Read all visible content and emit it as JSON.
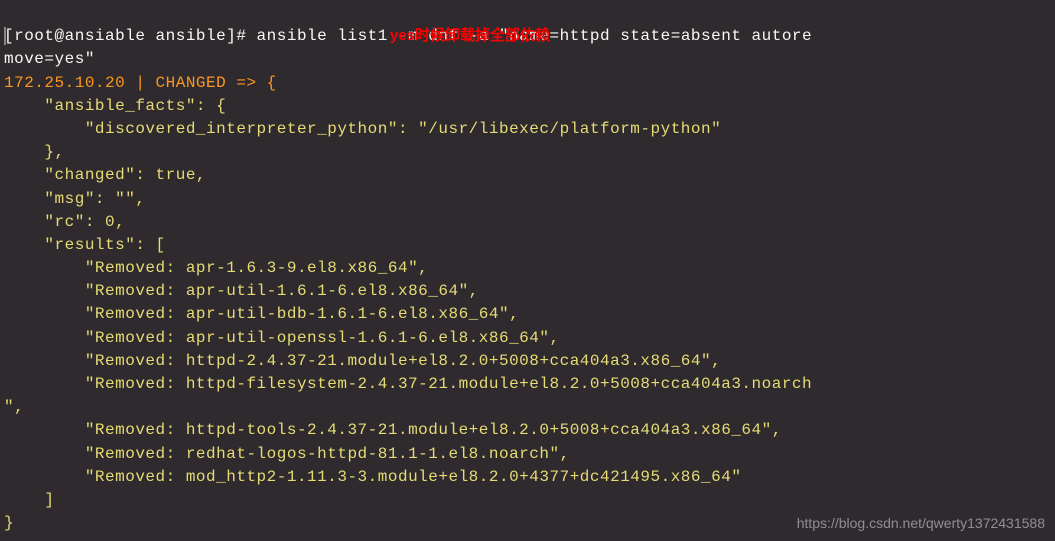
{
  "terminal": {
    "prompt": "[root@ansiable ansible]# ",
    "command": "ansible list1 -m dnf -a \"name=httpd state=absent autoremove=yes\"",
    "host_status": "172.25.10.20 | CHANGED => {",
    "ansible_facts_key": "    \"ansible_facts\": {",
    "interpreter_line": "        \"discovered_interpreter_python\": \"/usr/libexec/platform-python\"",
    "close_brace1": "    },",
    "changed_line": "    \"changed\": true,",
    "msg_line": "    \"msg\": \"\",",
    "rc_line": "    \"rc\": 0,",
    "results_open": "    \"results\": [",
    "results": [
      "        \"Removed: apr-1.6.3-9.el8.x86_64\",",
      "        \"Removed: apr-util-1.6.1-6.el8.x86_64\",",
      "        \"Removed: apr-util-bdb-1.6.1-6.el8.x86_64\",",
      "        \"Removed: apr-util-openssl-1.6.1-6.el8.x86_64\",",
      "        \"Removed: httpd-2.4.37-21.module+el8.2.0+5008+cca404a3.x86_64\",",
      "        \"Removed: httpd-filesystem-2.4.37-21.module+el8.2.0+5008+cca404a3.noarch\",",
      "        \"Removed: httpd-tools-2.4.37-21.module+el8.2.0+5008+cca404a3.x86_64\",",
      "        \"Removed: redhat-logos-httpd-81.1-1.el8.noarch\",",
      "        \"Removed: mod_http2-1.11.3-3.module+el8.2.0+4377+dc421495.x86_64\""
    ],
    "results_close": "    ]",
    "final_close": "}"
  },
  "annotation": "yes时候卸载掉全部依赖",
  "watermark": "https://blog.csdn.net/qwerty1372431588"
}
